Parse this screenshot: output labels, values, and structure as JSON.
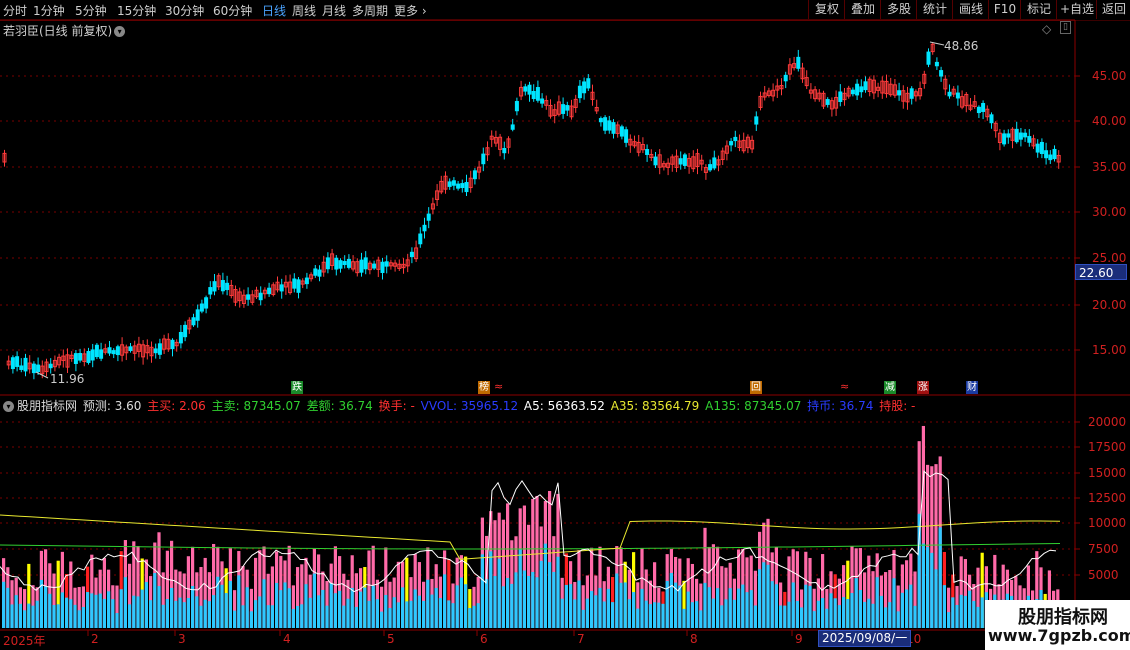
{
  "toolbar": {
    "periods": [
      {
        "label": "分时",
        "x": 3
      },
      {
        "label": "1分钟",
        "x": 33
      },
      {
        "label": "5分钟",
        "x": 75
      },
      {
        "label": "15分钟",
        "x": 117
      },
      {
        "label": "30分钟",
        "x": 165
      },
      {
        "label": "60分钟",
        "x": 213
      },
      {
        "label": "日线",
        "x": 262,
        "active": true
      },
      {
        "label": "周线",
        "x": 292
      },
      {
        "label": "月线",
        "x": 322
      },
      {
        "label": "多周期",
        "x": 352
      },
      {
        "label": "更多",
        "x": 394
      }
    ],
    "tools": [
      "复权",
      "叠加",
      "多股",
      "统计",
      "画线",
      "F10",
      "标记",
      "+自选",
      "返回"
    ]
  },
  "main_chart": {
    "title": "若羽臣(日线 前复权)",
    "high_label": "48.86",
    "low_label": "11.96",
    "current_price": "22.60",
    "y_ticks": [
      "45.00",
      "40.00",
      "35.00",
      "30.00",
      "25.00",
      "20.00",
      "15.00"
    ],
    "event_tags": [
      {
        "text": "跌",
        "color": "#1a8a2a"
      },
      {
        "text": "榜",
        "color": "#c06a00"
      },
      {
        "text": "回",
        "color": "#c06a00"
      },
      {
        "text": "减",
        "color": "#1a8a2a"
      },
      {
        "text": "涨",
        "color": "#a01010"
      },
      {
        "text": "财",
        "color": "#1a3aa0"
      }
    ]
  },
  "indicator": {
    "name": "股朋指标网",
    "items": [
      {
        "label": "预测:",
        "value": "3.60",
        "color": "#dddddd"
      },
      {
        "label": "主买:",
        "value": "2.06",
        "color": "#ff3030"
      },
      {
        "label": "主卖:",
        "value": "87345.07",
        "color": "#30d030"
      },
      {
        "label": "差额:",
        "value": "36.74",
        "color": "#30d030"
      },
      {
        "label": "换手:",
        "value": "-",
        "color": "#ff3030"
      },
      {
        "label": "VVOL:",
        "value": "35965.12",
        "color": "#2a3cff"
      },
      {
        "label": "A5:",
        "value": "56363.52",
        "color": "#ffffff"
      },
      {
        "label": "A35:",
        "value": "83564.79",
        "color": "#e8e830"
      },
      {
        "label": "A135:",
        "value": "87345.07",
        "color": "#30d030"
      },
      {
        "label": "持币:",
        "value": "36.74",
        "color": "#2a3cff"
      },
      {
        "label": "持股:",
        "value": "-",
        "color": "#ff3030"
      }
    ],
    "y_ticks": [
      "20000",
      "17500",
      "15000",
      "12500",
      "10000",
      "7500",
      "5000"
    ]
  },
  "x_axis": {
    "labels": [
      "2025年",
      "2",
      "3",
      "4",
      "5",
      "6",
      "7",
      "8",
      "9",
      "10"
    ],
    "cursor_date": "2025/09/08/一"
  },
  "watermark": {
    "line1": "股朋指标网",
    "line2": "www.7gpzb.com"
  },
  "colors": {
    "up": "#ff3b3b",
    "down": "#00e5ff",
    "bar_pink": "#ff6aa8",
    "bar_cyan": "#2ec8ff",
    "bar_yellow": "#ffff00",
    "bar_red": "#ff2020"
  }
}
